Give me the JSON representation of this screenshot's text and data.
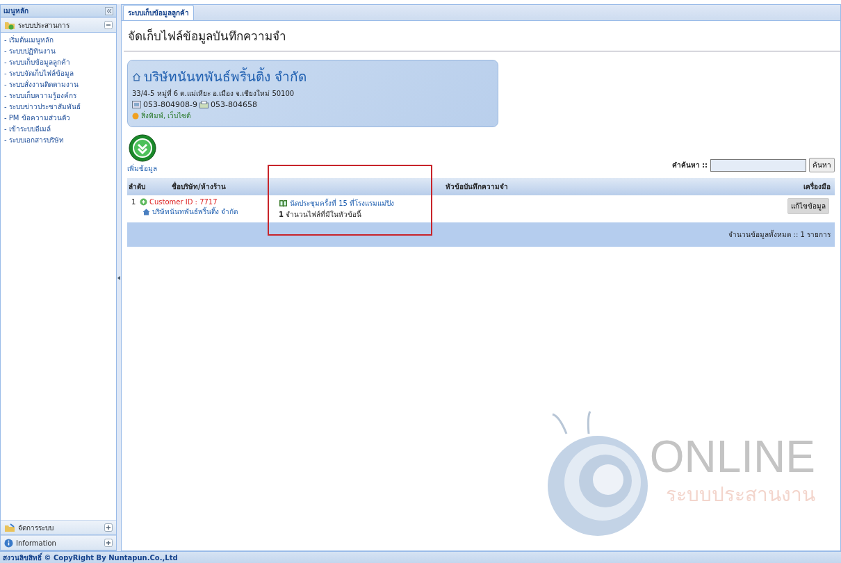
{
  "sidebar": {
    "title": "เมนูหลัก",
    "sections": [
      {
        "label": "ระบบประสานการ",
        "expanded": true,
        "items": [
          "- เริ่มต้นเมนูหลัก",
          "- ระบบปฏิทินงาน",
          "- ระบบเก็บข้อมูลลูกค้า",
          "- ระบบจัดเก็บไฟล์ข้อมูล",
          "- ระบบสั่งงานติดตามงาน",
          "- ระบบเก็บความรู้องค์กร",
          "- ระบบข่าวประชาสัมพันธ์",
          "- PM ข้อความส่วนตัว",
          "- เข้าระบบอีเมล์",
          "- ระบบเอกสารบริษัท"
        ]
      },
      {
        "label": "จัดการระบบ",
        "expanded": false
      },
      {
        "label": "Information",
        "expanded": false
      }
    ]
  },
  "tabs": [
    {
      "label": "ระบบเก็บข้อมูลลูกค้า",
      "selected": true
    }
  ],
  "page_title": "จัดเก็บไฟล์ข้อมูลบันทึกความจำ",
  "company": {
    "name": "บริษัทนันทพันธ์พริ้นติ้ง จำกัด",
    "address": "33/4-5 หมู่ที่ 6 ต.แม่เหียะ อ.เมือง จ.เชียงใหม่ 50100",
    "phone": "053-804908-9",
    "fax": "053-804658",
    "links": "สิ่งพิมพ์, เว็บไซต์"
  },
  "add_button": "เพิ่มข้อมูล",
  "search": {
    "label": "คำค้นหา ::",
    "button": "ค้นหา"
  },
  "table": {
    "columns": [
      "ลำดับ",
      "ชื่อบริษัท/ห้างร้าน",
      "หัวข้อบันทึกความจำ",
      "เครื่องมือ"
    ],
    "rows": [
      {
        "index": "1",
        "customer_id": "Customer ID : 7717",
        "company": "บริษัทนันทพันธ์พริ้นติ้ง จำกัด",
        "topic": "นัดประชุมครั้งที่ 15 ที่โรงแรมแม่ปิง",
        "file_count": "1",
        "file_count_label": "จำนวนไฟล์ที่มีในหัวข้อนี้",
        "action": "แก้ไขข้อมูล"
      }
    ],
    "total": "จำนวนข้อมูลทั้งหมด :: 1 รายการ"
  },
  "logo": {
    "word": "ONLINE",
    "tagline": "ระบบประสานงาน"
  },
  "footer": "สงวนลิขสิทธิ์ © CopyRight By Nuntapun.Co.,Ltd"
}
